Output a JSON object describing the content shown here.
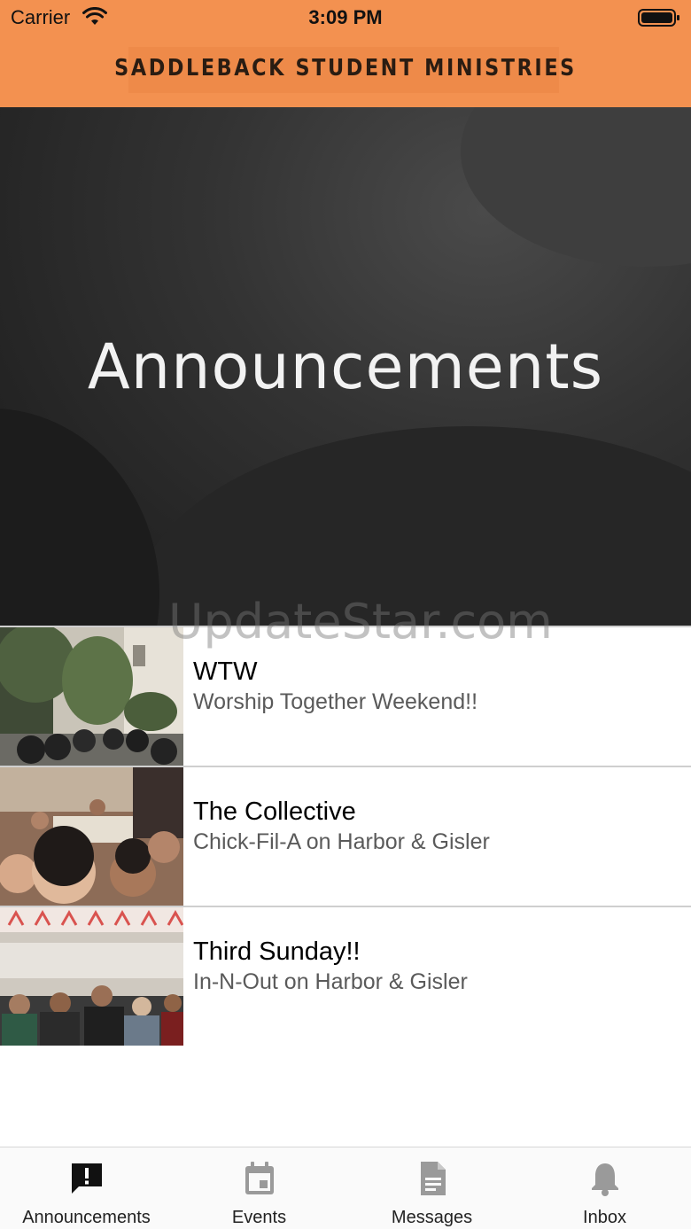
{
  "status_bar": {
    "carrier": "Carrier",
    "time": "3:09 PM"
  },
  "header": {
    "title": "SADDLEBACK STUDENT MINISTRIES",
    "background_color": "#f39150"
  },
  "hero": {
    "title": "Announcements",
    "watermark": "UpdateStar.com"
  },
  "announcements": [
    {
      "title": "WTW",
      "subtitle": "Worship Together Weekend!!"
    },
    {
      "title": "The Collective",
      "subtitle": "Chick-Fil-A on Harbor & Gisler"
    },
    {
      "title": "Third Sunday!!",
      "subtitle": "In-N-Out on Harbor & Gisler"
    }
  ],
  "tab_bar": {
    "tabs": [
      {
        "label": "Announcements",
        "icon": "announcement-icon",
        "active": true
      },
      {
        "label": "Events",
        "icon": "calendar-icon",
        "active": false
      },
      {
        "label": "Messages",
        "icon": "document-icon",
        "active": false
      },
      {
        "label": "Inbox",
        "icon": "bell-icon",
        "active": false
      }
    ]
  }
}
